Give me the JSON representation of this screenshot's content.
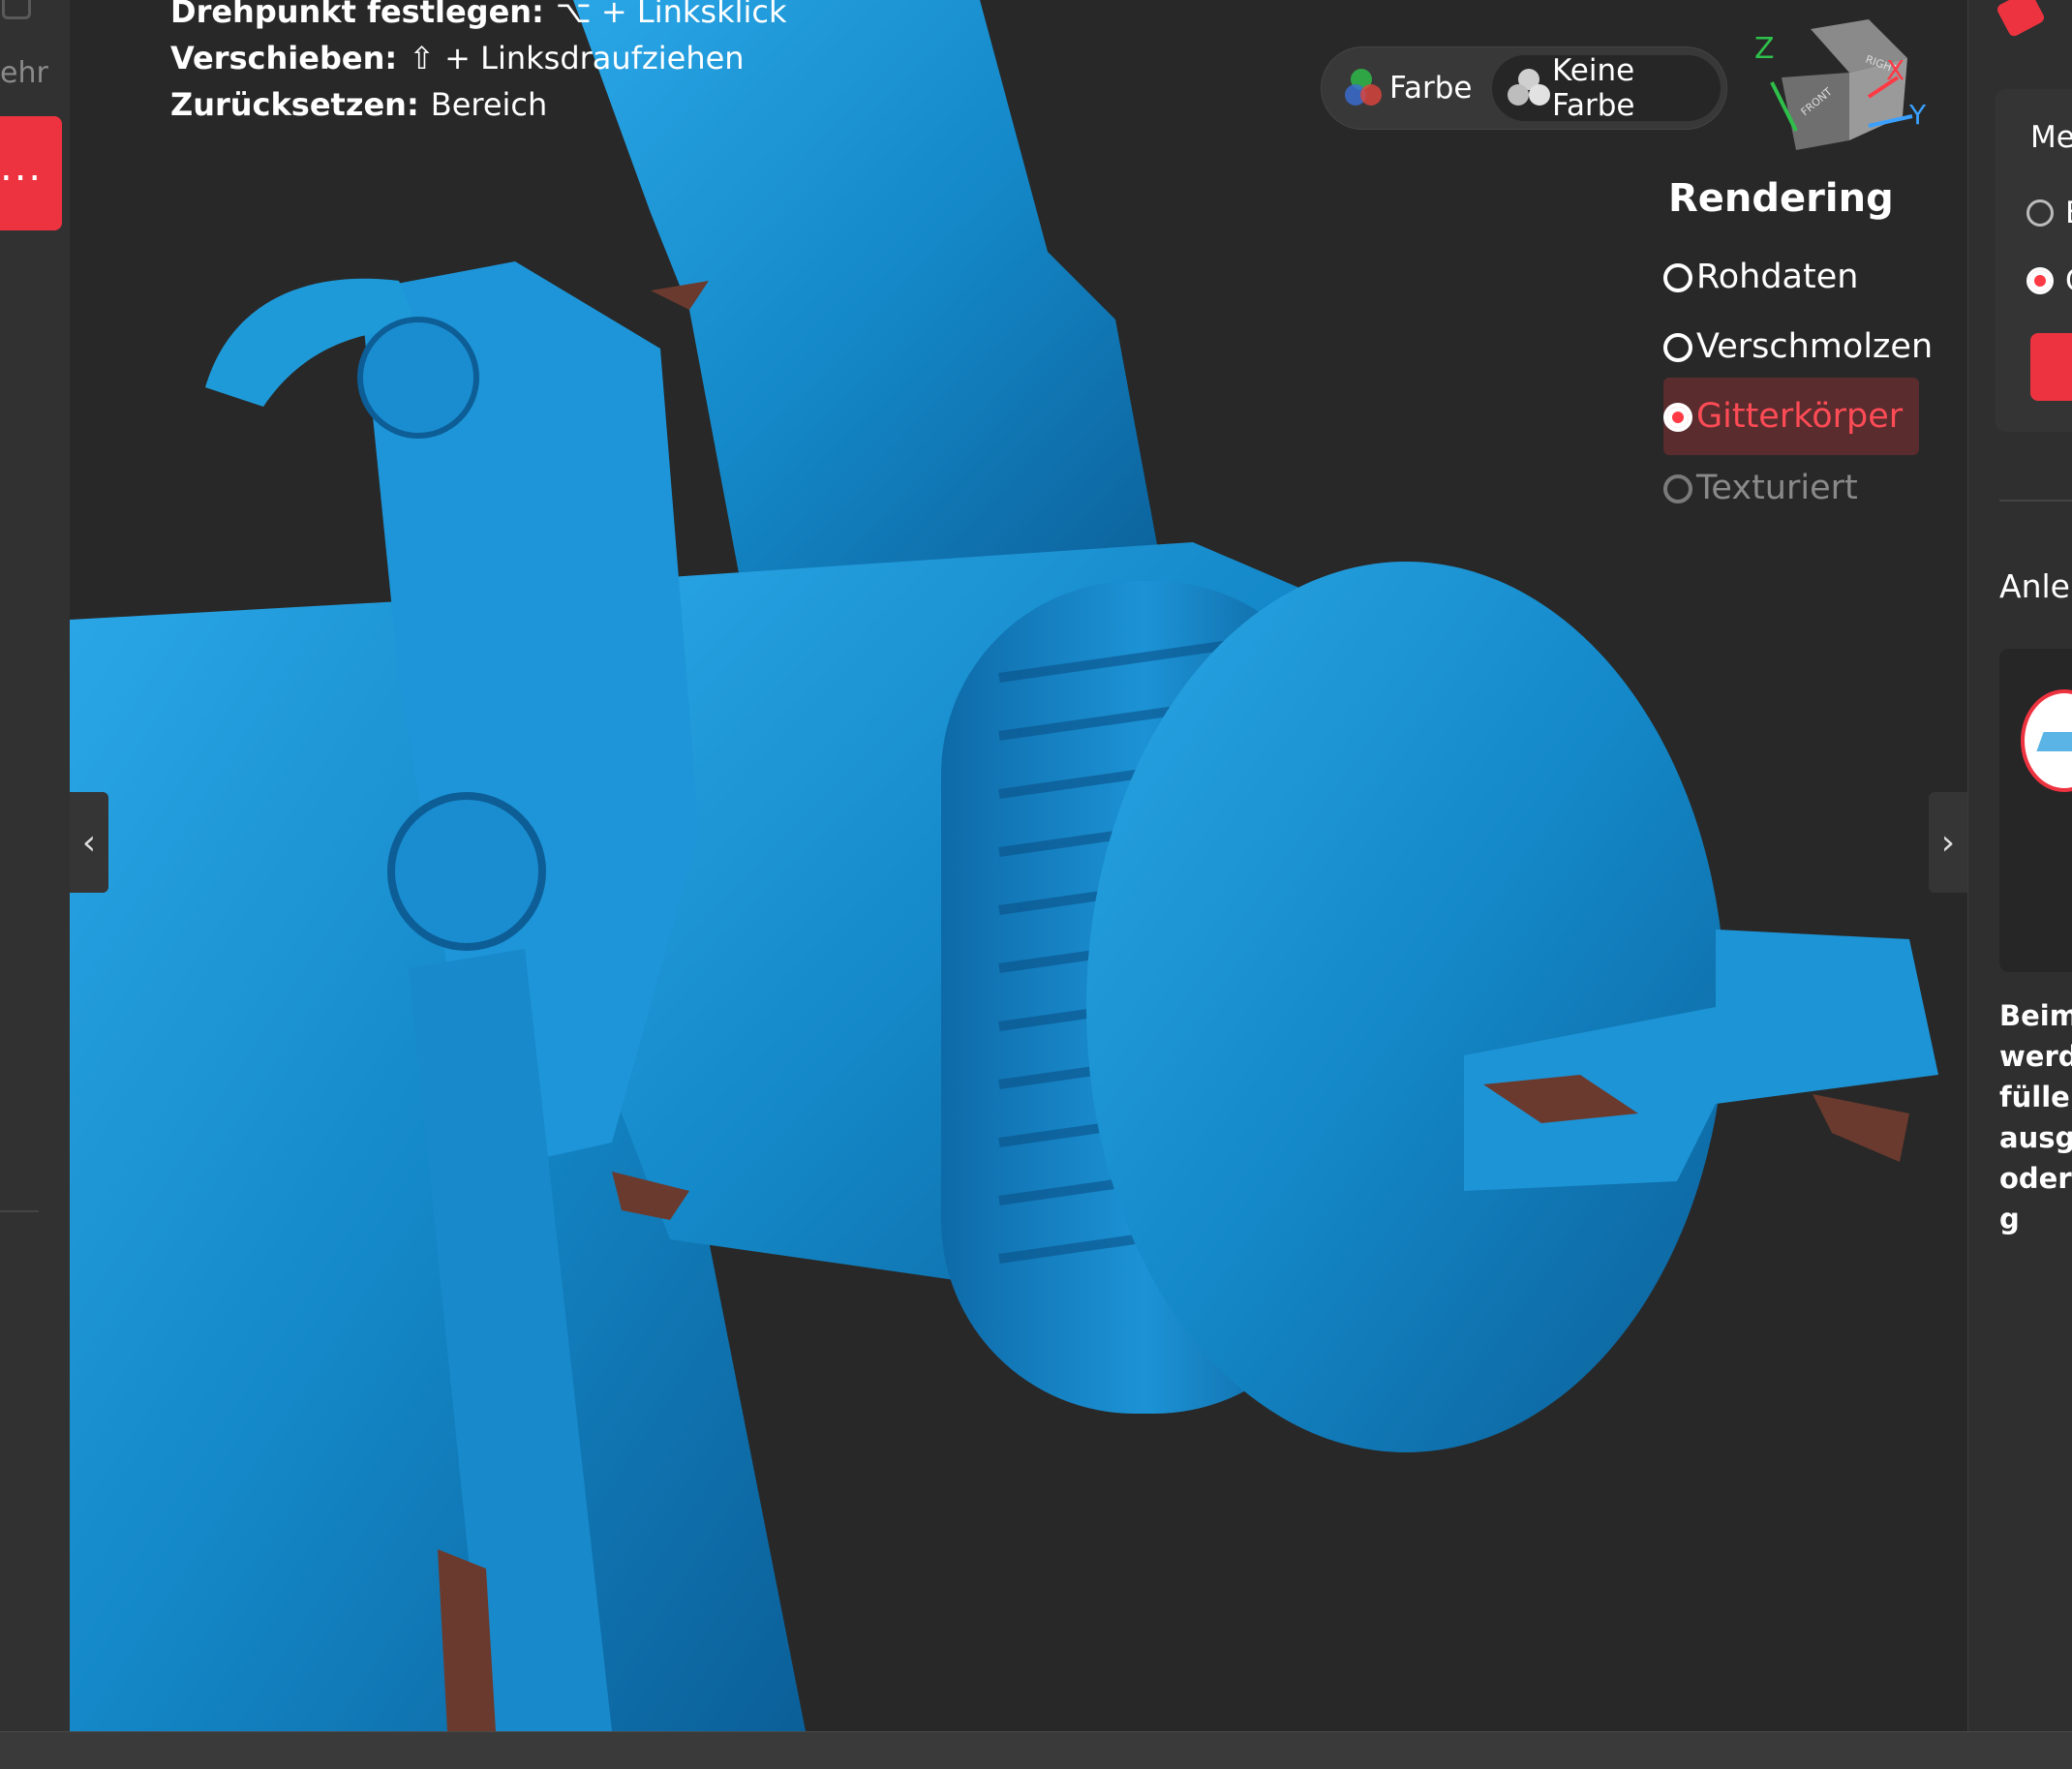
{
  "left_sidebar": {
    "more_label": "ehr",
    "tab_label": "..."
  },
  "hints": [
    {
      "label": "Drehpunkt festlegen:",
      "value": "⌥ + Linksklick"
    },
    {
      "label": "Verschieben:",
      "value": "⇧ + Linksdraufziehen"
    },
    {
      "label": "Zurücksetzen:",
      "value": "Bereich"
    }
  ],
  "color_toggle": {
    "options": [
      "Farbe",
      "Keine Farbe"
    ],
    "selected": "Keine Farbe"
  },
  "nav_cube": {
    "axes": [
      "Z",
      "X",
      "Y"
    ],
    "faces": [
      "FRONT",
      "RIGHT"
    ],
    "axis_colors": {
      "Z": "#2ec04a",
      "X": "#ff3a45",
      "Y": "#3aa0ff"
    }
  },
  "rendering": {
    "title": "Rendering",
    "options": [
      "Rohdaten",
      "Verschmolzen",
      "Gitterkörper",
      "Texturiert"
    ],
    "selected": "Gitterkörper",
    "disabled": "Texturiert"
  },
  "right_panel": {
    "method_label": "Met",
    "options": [
      "E",
      "G"
    ],
    "guide_title": "Anlei",
    "guide_text": [
      "Beim",
      "werde",
      "füllen",
      "ausge",
      "oder g"
    ]
  },
  "colors": {
    "accent": "#ee3340",
    "model": "#1a8fd0",
    "background": "#282828"
  },
  "icons": {
    "collapse_left": "‹",
    "collapse_right": "›"
  }
}
